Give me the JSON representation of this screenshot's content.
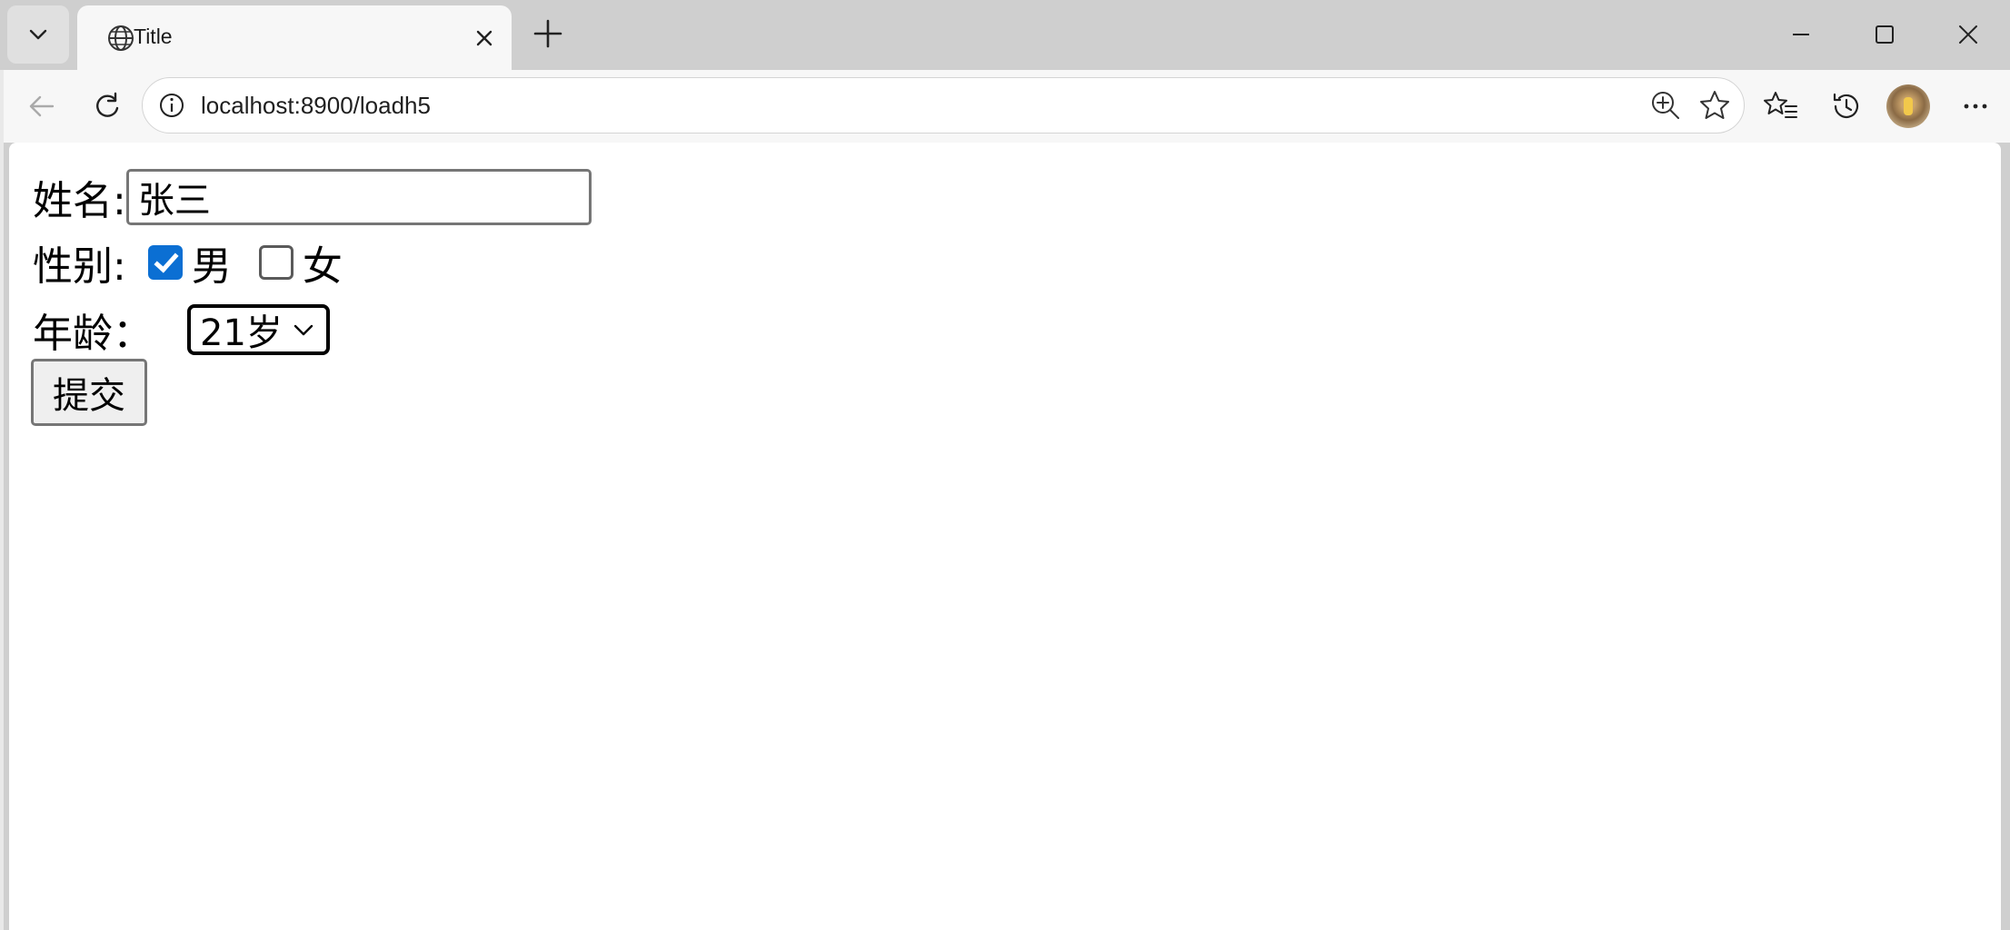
{
  "browser": {
    "tab_title": "Title",
    "url": "localhost:8900/loadh5"
  },
  "form": {
    "name_label": "姓名:",
    "name_value": "张三",
    "gender_label": "性别:",
    "gender_options": [
      {
        "label": "男",
        "checked": true
      },
      {
        "label": "女",
        "checked": false
      }
    ],
    "age_label": "年龄：",
    "age_selected": "21岁",
    "submit_label": "提交"
  },
  "colors": {
    "accent": "#0b6fd3"
  }
}
